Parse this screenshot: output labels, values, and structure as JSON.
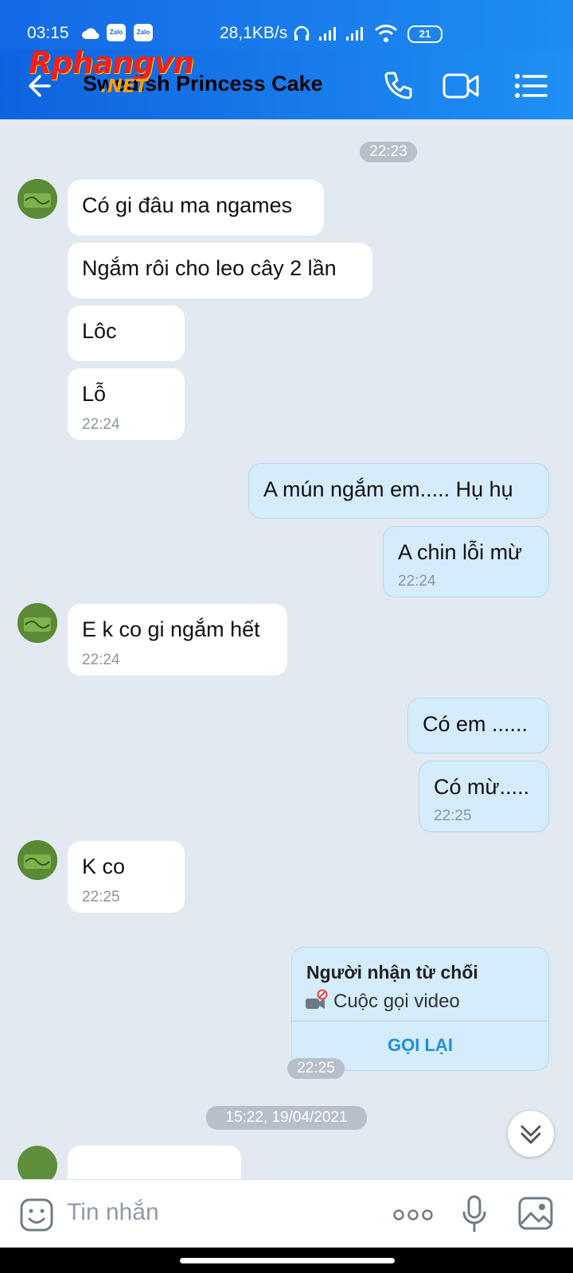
{
  "status_bar": {
    "time": "03:15",
    "speed": "28,1KB/s",
    "battery": "21",
    "app_badges": [
      "Zalo",
      "Zalo"
    ]
  },
  "watermark": {
    "brand": "Rphangvn",
    "suffix": ".NET"
  },
  "header": {
    "title": "Swedish Princess Cake"
  },
  "chat": {
    "date_pills": [
      "22:23",
      "15:22, 19/04/2021"
    ],
    "messages": [
      {
        "text": "Có gi đâu ma ngames",
        "time": ""
      },
      {
        "text": "Ngắm rôi cho leo cây 2 lần",
        "time": ""
      },
      {
        "text": "Lôc",
        "time": ""
      },
      {
        "text": "Lỗ",
        "time": "22:24"
      },
      {
        "text": "A mún ngắm em..... Hụ hụ",
        "time": ""
      },
      {
        "text": "A chin lỗi mừ",
        "time": "22:24"
      },
      {
        "text": "E k co gi ngắm hết",
        "time": "22:24"
      },
      {
        "text": "Có em ......",
        "time": ""
      },
      {
        "text": "Có mừ.....",
        "time": "22:25"
      },
      {
        "text": "K co",
        "time": "22:25"
      }
    ],
    "call_card": {
      "heading": "Người nhận từ chối",
      "subtitle": "Cuộc gọi video",
      "action": "GỌI LẠI",
      "time": "22:25"
    }
  },
  "input": {
    "placeholder": "Tin nhắn"
  },
  "colors": {
    "header": "#1f7cee",
    "outgoing_bubble": "#d4ecfc",
    "incoming_bubble": "#ffffff",
    "chat_bg": "#e2e9f1",
    "accent": "#1d8ee0"
  }
}
